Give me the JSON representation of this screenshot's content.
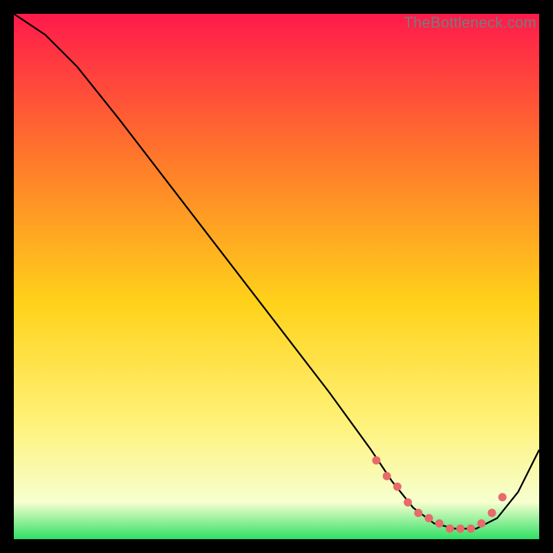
{
  "watermark": "TheBottleneck.com",
  "colors": {
    "bg": "#000000",
    "gradient_top": "#ff1a4b",
    "gradient_mid1": "#ff7a2a",
    "gradient_mid2": "#ffd21a",
    "gradient_mid3": "#fff27a",
    "gradient_bottom_a": "#f6ffd0",
    "gradient_bottom_b": "#2fe065",
    "curve": "#000000",
    "dots": "#e86a6a"
  },
  "chart_data": {
    "type": "line",
    "title": "",
    "xlabel": "",
    "ylabel": "",
    "xlim": [
      0,
      100
    ],
    "ylim": [
      0,
      100
    ],
    "series": [
      {
        "name": "bottleneck-curve",
        "x": [
          0,
          6,
          12,
          20,
          30,
          40,
          50,
          60,
          68,
          72,
          76,
          80,
          84,
          88,
          92,
          96,
          100
        ],
        "y": [
          100,
          96,
          90,
          80,
          67,
          54,
          41,
          28,
          17,
          11,
          6,
          3,
          2,
          2,
          4,
          9,
          17
        ]
      }
    ],
    "dots": {
      "name": "highlight-dots",
      "x": [
        69,
        71,
        73,
        75,
        77,
        79,
        81,
        83,
        85,
        87,
        89,
        91,
        93
      ],
      "y": [
        15,
        12,
        10,
        7,
        5,
        4,
        3,
        2,
        2,
        2,
        3,
        5,
        8
      ]
    }
  }
}
